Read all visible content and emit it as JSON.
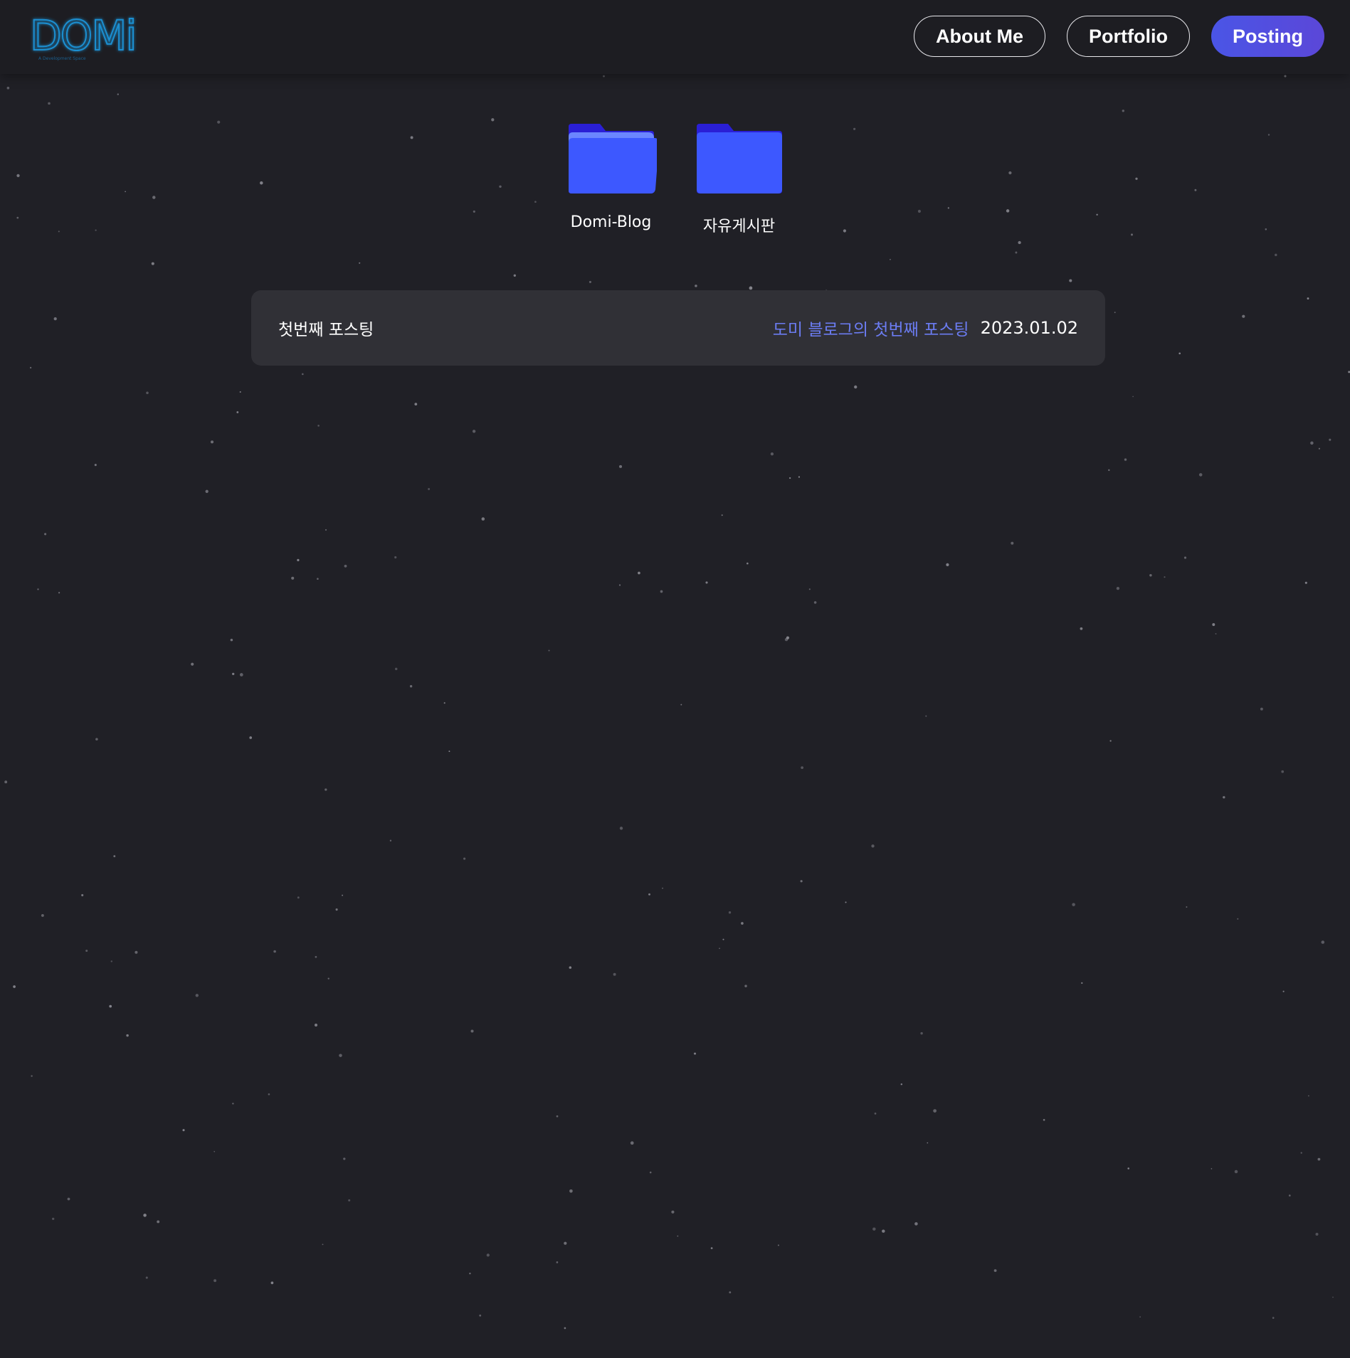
{
  "header": {
    "logo_text": "DOMi",
    "logo_subtext": "A Development Space",
    "nav": [
      {
        "label": "About Me",
        "active": false
      },
      {
        "label": "Portfolio",
        "active": false
      },
      {
        "label": "Posting",
        "active": true
      }
    ]
  },
  "folders": [
    {
      "label": "Domi-Blog",
      "icon": "folder-open-icon"
    },
    {
      "label": "자유게시판",
      "icon": "folder-icon"
    }
  ],
  "posts": [
    {
      "title": "첫번째 포스팅",
      "category": "도미 블로그의 첫번째 포스팅",
      "date": "2023.01.02"
    }
  ],
  "colors": {
    "background": "#202026",
    "header": "#1d1d22",
    "accent": "#4a55e6",
    "folder": "#3d58ff",
    "folder_tab": "#2a1fd6",
    "category_link": "#6b7cf2",
    "card": "#303036",
    "logo": "#1a8fd1"
  }
}
